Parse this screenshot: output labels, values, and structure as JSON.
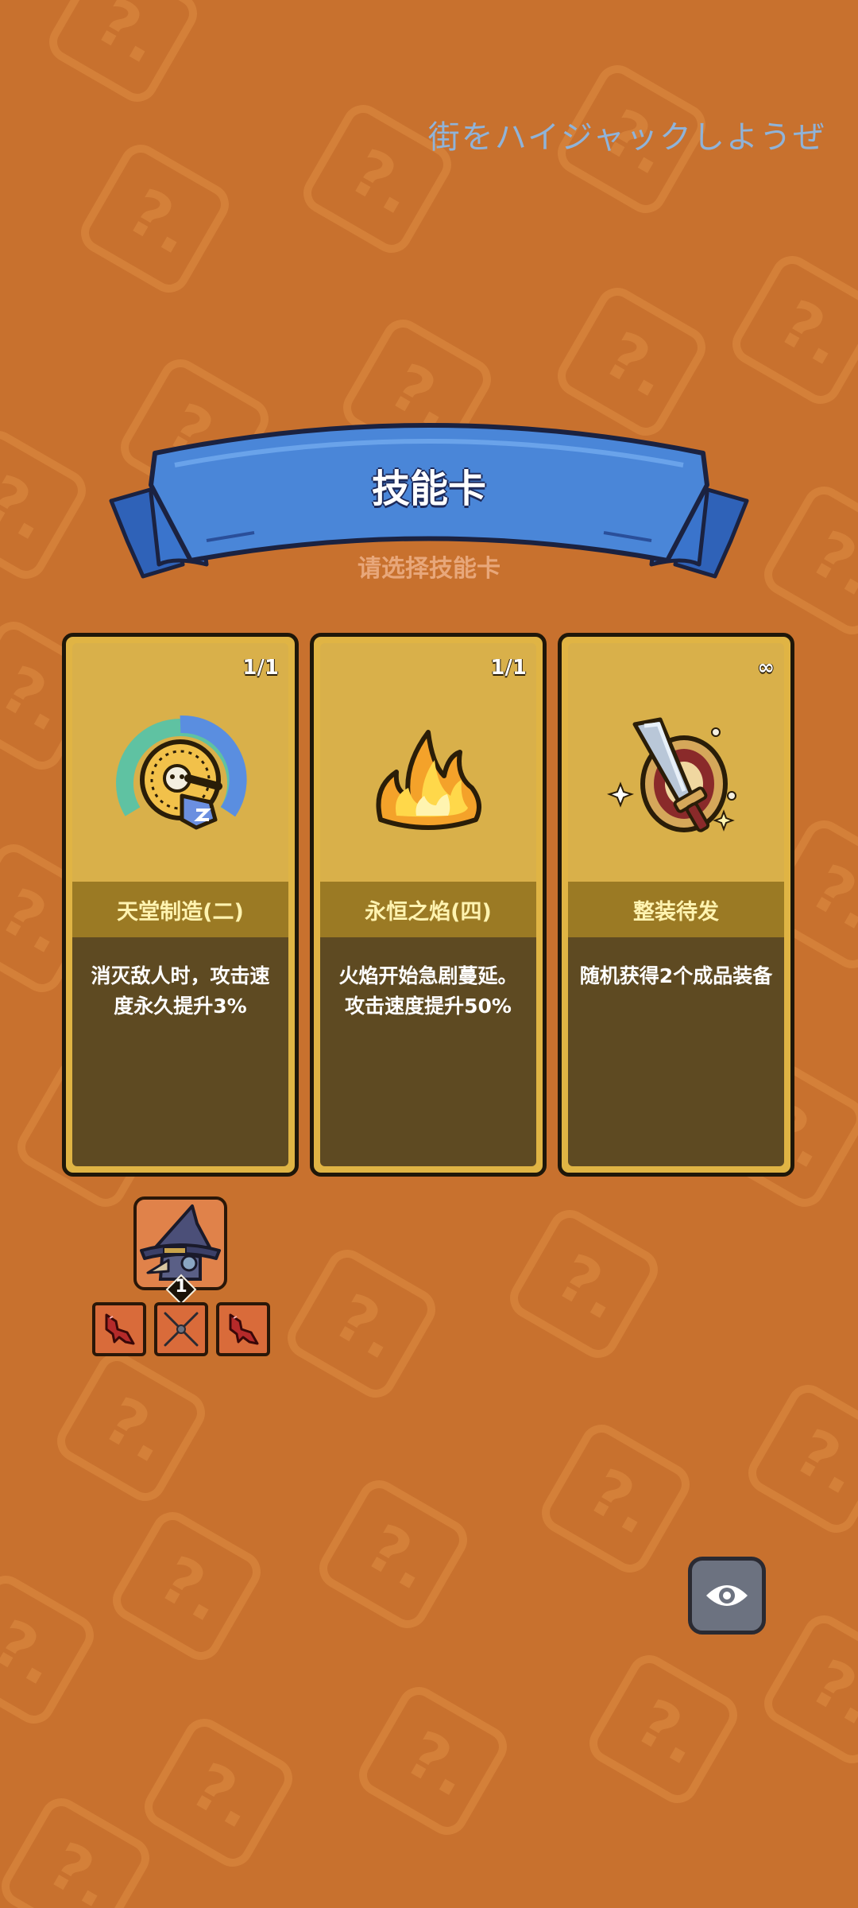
{
  "watermark": "街をハイジャックしようぜ",
  "banner": {
    "title": "技能卡",
    "subtitle": "请选择技能卡"
  },
  "cards": [
    {
      "count": "1/1",
      "name": "天堂制造(二)",
      "description": "消灭敌人时，攻击速度永久提升3%",
      "icon": "speed-gauge-icon"
    },
    {
      "count": "1/1",
      "name": "永恒之焰(四)",
      "description": "火焰开始急剧蔓延。攻击速度提升50%",
      "icon": "flame-icon"
    },
    {
      "count": "∞",
      "name": "整装待发",
      "description": "随机获得2个成品装备",
      "icon": "sword-shield-icon"
    }
  ],
  "hero": {
    "level": "1",
    "icon": "wizard-hero-icon"
  },
  "equipment": [
    {
      "icon": "red-claw-icon"
    },
    {
      "icon": "shuriken-icon"
    },
    {
      "icon": "red-claw-icon"
    }
  ],
  "view_button": {
    "icon": "eye-icon"
  },
  "colors": {
    "background": "#c8712e",
    "banner_blue": "#4a86d8",
    "card_gold": "#e0b444",
    "card_desc_bg": "#5e4a22",
    "card_name_bar": "#9b7a24"
  }
}
